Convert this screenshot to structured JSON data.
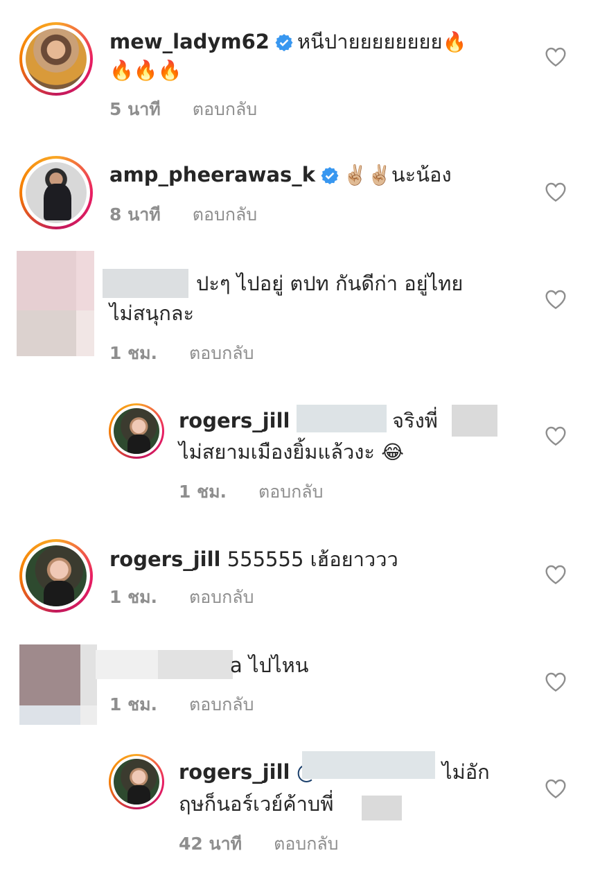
{
  "comments": [
    {
      "username": "mew_ladym62",
      "verified": true,
      "text_line1": "หนีปายยยยยยยย",
      "emoji_line1": "🔥",
      "text_line2": "🔥🔥🔥",
      "time": "5 นาที",
      "reply": "ตอบกลับ"
    },
    {
      "username": "amp_pheerawas_k",
      "verified": true,
      "emoji": "✌🏼✌🏼",
      "text": "นะน้อง",
      "time": "8 นาที",
      "reply": "ตอบกลับ"
    },
    {
      "text_line1": "ปะๆ ไปอยู่ ตปท กันดีก่า อยู่ไทย",
      "text_line2": "ไม่สนุกละ",
      "time": "1 ชม.",
      "reply": "ตอบกลับ"
    },
    {
      "username": "rogers_jill",
      "mention": "@",
      "text_line1": "จริงพี่",
      "text_line2": "ไม่สยามเมืองยิ้มแล้วงะ",
      "emoji": "😂",
      "time": "1 ชม.",
      "reply": "ตอบกลับ"
    },
    {
      "username": "rogers_jill",
      "text": "555555 เฮ้อยาววว",
      "time": "1 ชม.",
      "reply": "ตอบกลับ"
    },
    {
      "text_suffix": "a ไปไหน",
      "time": "1 ชม.",
      "reply": "ตอบกลับ"
    },
    {
      "username": "rogers_jill",
      "mention": "@",
      "text_line1": "ไม่อัก",
      "text_line2": "ฤษก็นอร์เวย์ค้าบพี่",
      "time": "42 นาที",
      "reply": "ตอบกลับ"
    }
  ],
  "colors": {
    "text": "#262626",
    "meta": "#8e8e8e",
    "verified": "#3897f0",
    "mention": "#1a3f6b",
    "ring_start": "#f9a825",
    "ring_end": "#c2185b"
  },
  "icons": {
    "verified": "verified-badge-icon",
    "like": "heart-outline-icon"
  }
}
